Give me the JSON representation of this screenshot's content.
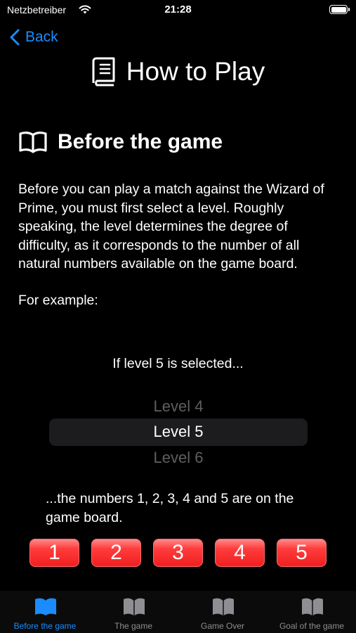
{
  "status_bar": {
    "carrier": "Netzbetreiber",
    "time": "21:28"
  },
  "nav": {
    "back_label": "Back"
  },
  "page": {
    "title": "How to Play"
  },
  "section": {
    "title": "Before the game",
    "body": "Before you can play a match against the Wizard of Prime, you must first select a level. Roughly speaking, the level determines the degree of difficulty, as it corresponds to the number of all natural numbers available on the game board.",
    "example_label": "For example:"
  },
  "example": {
    "if_text": "If level 5 is selected...",
    "picker": [
      "Level 4",
      "Level 5",
      "Level 6"
    ],
    "result_text": "...the numbers 1, 2, 3, 4 and 5 are on the game board.",
    "tiles": [
      "1",
      "2",
      "3",
      "4",
      "5"
    ]
  },
  "tabs": [
    {
      "label": "Before the game",
      "icon": "book-open-icon",
      "active": true
    },
    {
      "label": "The game",
      "icon": "book-open-icon",
      "active": false
    },
    {
      "label": "Game Over",
      "icon": "book-open-icon",
      "active": false
    },
    {
      "label": "Goal of the game",
      "icon": "book-open-icon",
      "active": false
    }
  ],
  "colors": {
    "accent": "#1a8cff",
    "tile_red": "#f01f1f",
    "inactive_tab": "#8e8e93"
  }
}
